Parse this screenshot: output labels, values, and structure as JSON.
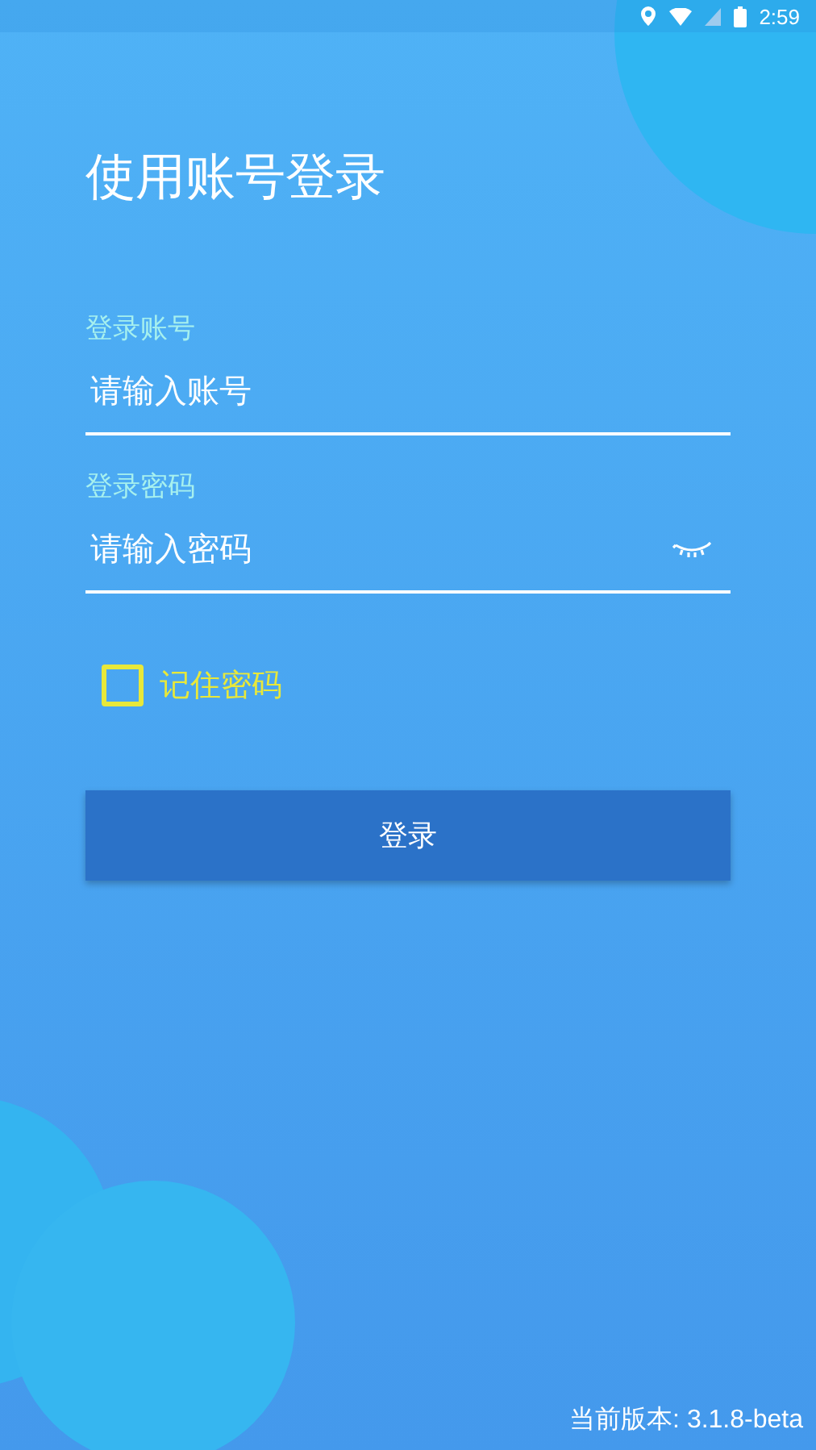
{
  "status_bar": {
    "time": "2:59"
  },
  "title": "使用账号登录",
  "fields": [
    {
      "label": "登录账号",
      "placeholder": "请输入账号",
      "kind": "text"
    },
    {
      "label": "登录密码",
      "placeholder": "请输入密码",
      "kind": "password"
    }
  ],
  "remember": {
    "label": "记住密码",
    "checked": false
  },
  "login_button": "登录",
  "version": "当前版本: 3.1.8-beta"
}
